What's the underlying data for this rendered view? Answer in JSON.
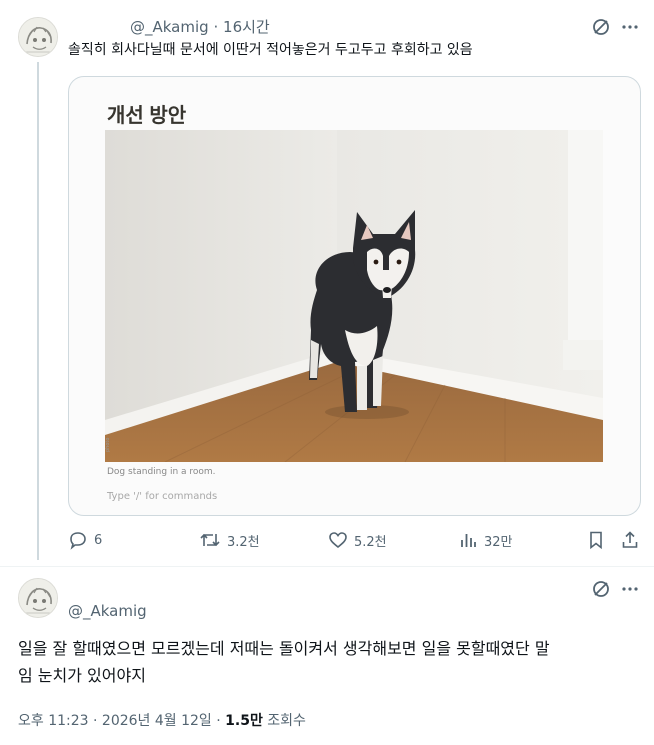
{
  "reply_tweet": {
    "handle": "@_Akamig",
    "separator": "·",
    "time": "16시간",
    "text": "솔직히 회사다닐때 문서에 이딴거 적어놓은거 두고두고 후회하고 있음",
    "media": {
      "doc_title": "개선 방안",
      "caption": "Dog standing in a room.",
      "command_hint": "Type '/' for commands"
    },
    "actions": {
      "replies": "6",
      "retweets": "3.2천",
      "likes": "5.2천",
      "views": "32만"
    }
  },
  "main_tweet": {
    "handle": "@_Akamig",
    "text_line1": "일을 잘 할때였으면 모르겠는데 저때는 돌이켜서 생각해보면 일을 못할때였단 말",
    "text_line2": "임 눈치가 있어야지",
    "timestamp": "오후 11:23 · 2026년 4월 12일 ·",
    "views_count": "1.5만",
    "views_label": "조회수"
  },
  "icons": [
    "grok-icon",
    "more-icon",
    "reply-icon",
    "retweet-icon",
    "like-icon",
    "views-icon",
    "bookmark-icon",
    "share-icon"
  ]
}
